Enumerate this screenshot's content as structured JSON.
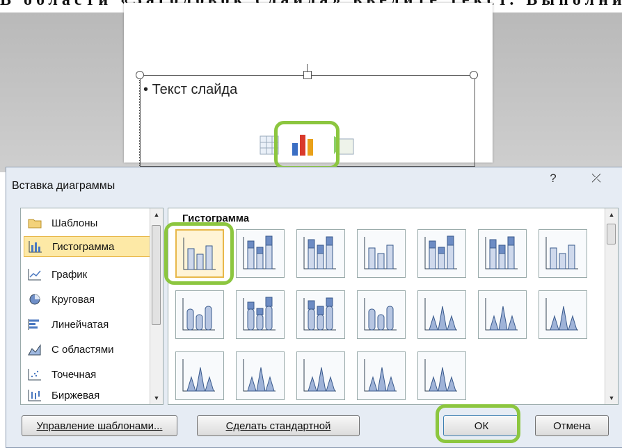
{
  "background_text": "В области «Заголовок слайда» введите текст. Выполните",
  "slide": {
    "bullet": "Текст слайда"
  },
  "dialog": {
    "title": "Вставка диаграммы",
    "help_glyph": "?",
    "close_glyph": "⤫",
    "categories": [
      {
        "label": "Шаблоны",
        "icon": "folder-icon"
      },
      {
        "label": "Гистограмма",
        "icon": "column-chart-icon",
        "selected": true
      },
      {
        "label": "График",
        "icon": "line-chart-icon"
      },
      {
        "label": "Круговая",
        "icon": "pie-chart-icon"
      },
      {
        "label": "Линейчатая",
        "icon": "bar-chart-icon"
      },
      {
        "label": "С областями",
        "icon": "area-chart-icon"
      },
      {
        "label": "Точечная",
        "icon": "scatter-chart-icon"
      },
      {
        "label": "Биржевая",
        "icon": "stock-chart-icon"
      }
    ],
    "section_title": "Гистограмма",
    "buttons": {
      "manage": "Управление шаблонами...",
      "set_default": "Сделать стандартной",
      "ok": "ОК",
      "cancel": "Отмена"
    }
  }
}
